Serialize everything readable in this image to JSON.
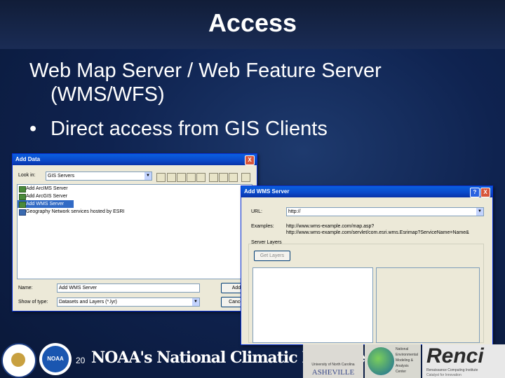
{
  "slide": {
    "title": "Access",
    "line1": "Web Map Server / Web Feature Server",
    "line2": "(WMS/WFS)",
    "bullet": "Direct access from GIS Clients",
    "bullet_glyph": "•",
    "slide_number": "20"
  },
  "add_data": {
    "title": "Add Data",
    "look_in_label": "Look in:",
    "look_in_value": "GIS Servers",
    "items": [
      "Add ArcIMS Server",
      "Add ArcGIS Server",
      "Add WMS Server",
      "Geography Network services hosted by ESRI"
    ],
    "selected_index": 2,
    "name_label": "Name:",
    "name_value": "Add WMS Server",
    "show_label": "Show of type:",
    "show_value": "Datasets and Layers (*.lyr)",
    "add_button": "Add",
    "cancel_button": "Cancel",
    "close_glyph": "X"
  },
  "add_wms": {
    "title": "Add WMS Server",
    "url_label": "URL:",
    "url_value": "http://",
    "examples_label": "Examples:",
    "example1": "http://www.wms-example.com/map.asp?",
    "example2": "http://www.wms-example.com/servlet/com.esri.wms.Esrimap?ServiceName=Name&",
    "layers_label": "Server Layers",
    "get_layers_button": "Get Layers",
    "help_glyph": "?",
    "close_glyph": "X"
  },
  "footer": {
    "ncdc_text": "NOAA's National Climatic Data Center",
    "noaa_text": "NOAA",
    "unca_line1": "University of North Carolina",
    "unca_line2": "ASHEVILLE",
    "nemac_lines": [
      "National",
      "Environmental",
      "Modeling &",
      "Analysis",
      "Center"
    ],
    "renci_text": "Renci",
    "renci_sub1": "Renaissance Computing Institute",
    "renci_sub2": "Catalyst for Innovation"
  }
}
